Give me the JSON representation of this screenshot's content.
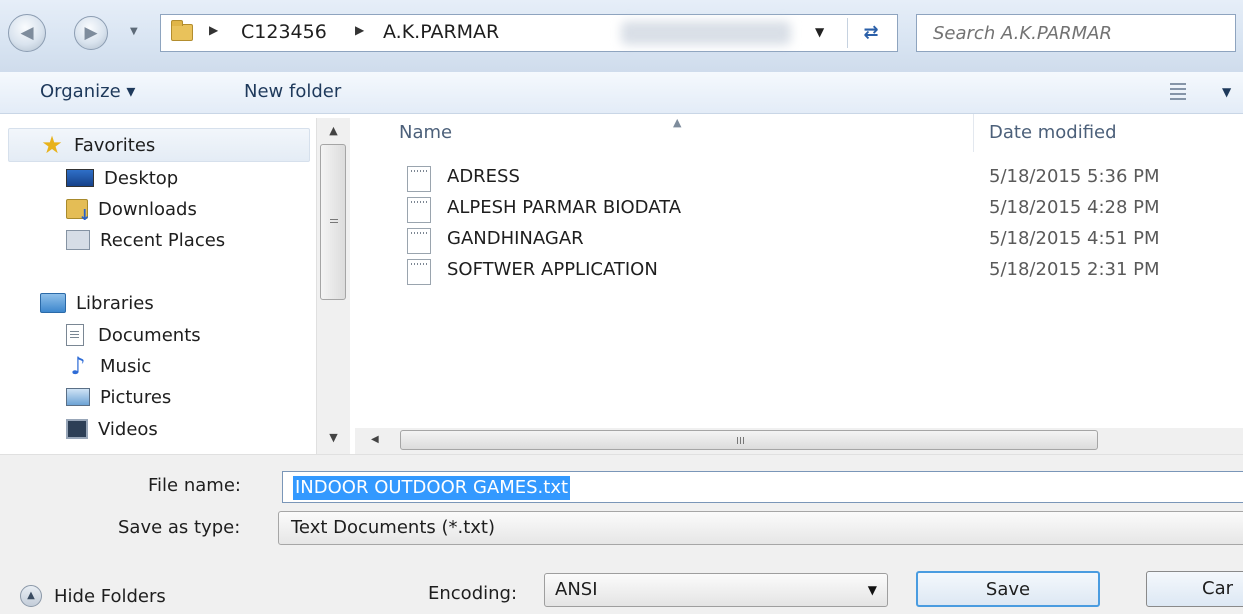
{
  "address_bar": {
    "path": [
      "C123456",
      "A.K.PARMAR"
    ],
    "search_placeholder": "Search A.K.PARMAR"
  },
  "toolbar": {
    "organize_label": "Organize ▾",
    "new_folder_label": "New folder"
  },
  "nav_pane": {
    "favorites_header": "Favorites",
    "favorites": [
      "Desktop",
      "Downloads",
      "Recent Places"
    ],
    "libraries_header": "Libraries",
    "libraries": [
      "Documents",
      "Music",
      "Pictures",
      "Videos"
    ]
  },
  "file_list": {
    "columns": [
      "Name",
      "Date modified"
    ],
    "files": [
      {
        "name": "ADRESS",
        "date": "5/18/2015 5:36 PM"
      },
      {
        "name": "ALPESH PARMAR BIODATA",
        "date": "5/18/2015 4:28 PM"
      },
      {
        "name": "GANDHINAGAR",
        "date": "5/18/2015 4:51 PM"
      },
      {
        "name": "SOFTWER APPLICATION",
        "date": "5/18/2015 2:31 PM"
      }
    ],
    "hscroll_grip": "III"
  },
  "form": {
    "file_name_label": "File name:",
    "file_name_value": "INDOOR OUTDOOR GAMES.txt",
    "save_type_label": "Save as type:",
    "save_type_value": "Text Documents (*.txt)",
    "encoding_label": "Encoding:",
    "encoding_value": "ANSI",
    "hide_folders_label": "Hide Folders",
    "save_label": "Save",
    "cancel_label": "Car"
  },
  "colors": {
    "selection": "#3399ff",
    "header_text": "#4c607a",
    "toolbar_text": "#1e395b"
  },
  "icons": [
    "back-icon",
    "forward-icon",
    "folder-icon",
    "refresh-icon",
    "star-icon",
    "desktop-icon",
    "downloads-icon",
    "recent-places-icon",
    "libraries-icon",
    "documents-icon",
    "music-icon",
    "pictures-icon",
    "videos-icon",
    "text-file-icon",
    "view-icon"
  ]
}
